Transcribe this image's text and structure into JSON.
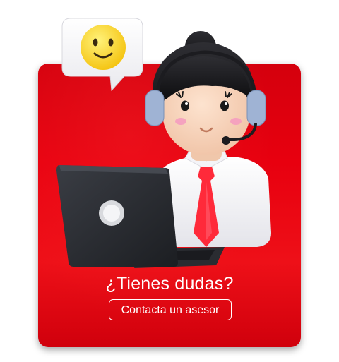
{
  "banner": {
    "headline": "¿Tienes dudas?",
    "cta_label": "Contacta un asesor"
  },
  "icons": {
    "chat_bubble": "smiley-chat-bubble-icon",
    "agent": "customer-service-agent-illustration",
    "laptop": "laptop-icon"
  },
  "colors": {
    "card_red": "#e8000f",
    "text": "#ffffff",
    "tie_red": "#ff2a3a"
  }
}
